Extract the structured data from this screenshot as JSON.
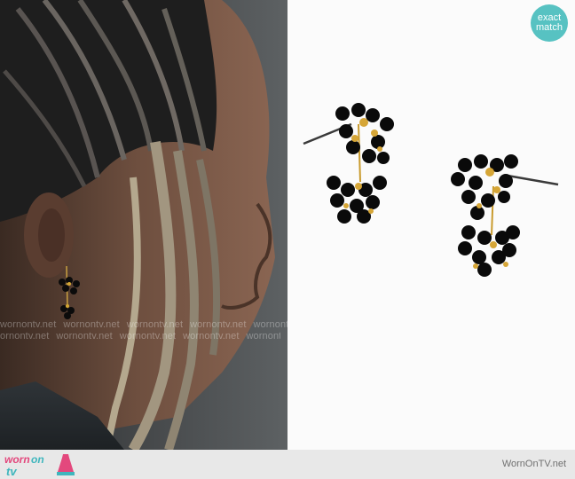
{
  "watermark": {
    "text": "wornontv.net"
  },
  "badge": {
    "line1": "exact",
    "line2": "match",
    "color": "#57c2c2"
  },
  "footer": {
    "logo_word1": "worn",
    "logo_word2": "on",
    "logo_word3": "tv",
    "site_text": "WornOnTV.net",
    "brand_pink": "#e3487d",
    "brand_teal": "#3fb6bd"
  }
}
